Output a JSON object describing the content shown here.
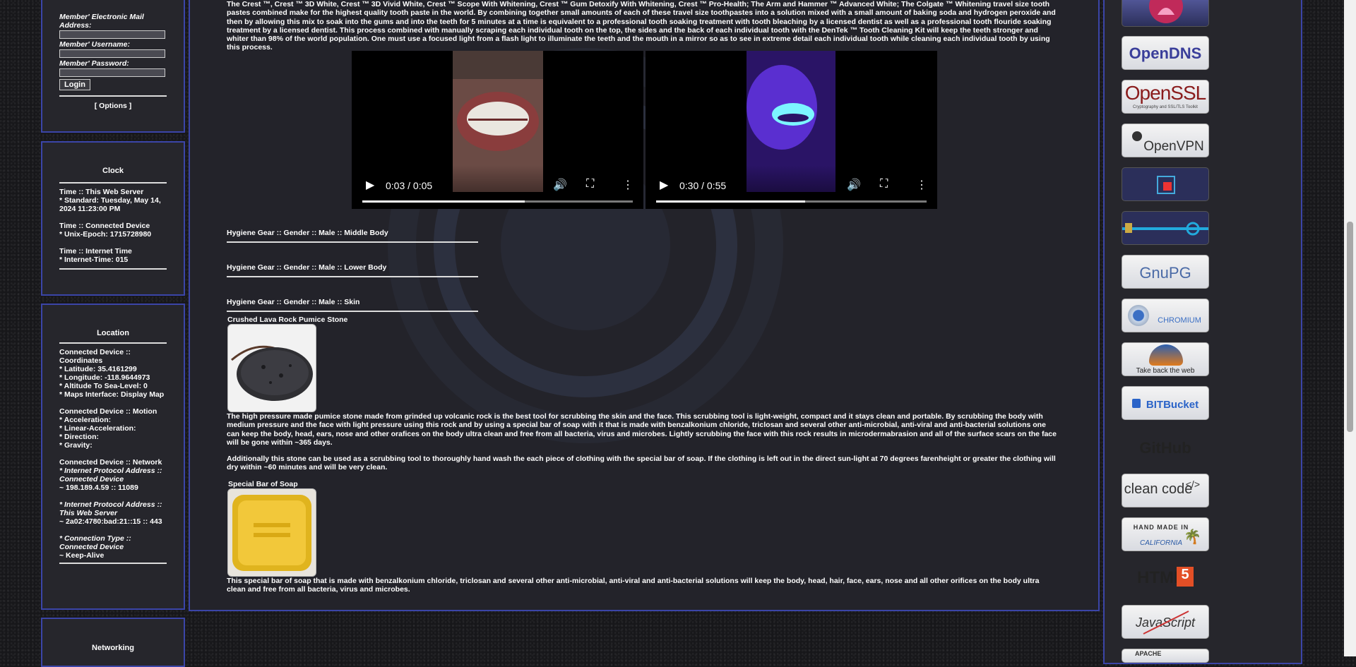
{
  "login": {
    "email_label": "Member' Electronic Mail Address:",
    "username_label": "Member' Username:",
    "password_label": "Member' Password:",
    "login_button": "Login",
    "options_link": "[ Options ]"
  },
  "clock": {
    "title": "Clock",
    "server_heading": "Time :: This Web Server",
    "server_value": "* Standard: Tuesday, May 14, 2024 11:23:00 PM",
    "device_heading": "Time :: Connected Device",
    "device_value": "* Unix-Epoch: 1715728980",
    "internet_heading": "Time :: Internet Time",
    "internet_value": "* Internet-Time: 015"
  },
  "location": {
    "title": "Location",
    "coords_heading": "Connected Device :: Coordinates",
    "latitude": "* Latitude: 35.4161299",
    "longitude": "* Longitude: -118.9644973",
    "altitude": "* Altitude To Sea-Level: 0",
    "maps_label": "* Maps Interface:",
    "maps_link": "Display Map",
    "motion_heading": "Connected Device :: Motion",
    "acceleration": "* Acceleration:",
    "linear_acceleration": "* Linear-Acceleration:",
    "direction": "* Direction:",
    "gravity": "* Gravity:",
    "network_heading": "Connected Device :: Network",
    "ip_device_label": "* Internet Protocol Address :: Connected Device",
    "ip_device_value": "~ 198.189.4.59 :: 11089",
    "ip_server_label": "* Internet Protocol Address :: This Web Server",
    "ip_server_value": "~ 2a02:4780:bad:21::15 :: 443",
    "conn_type_label": "* Connection Type :: Connected Device",
    "conn_type_value": "~ Keep-Alive"
  },
  "networking": {
    "title": "Networking"
  },
  "main": {
    "intro": "The Crest ™, Crest ™ 3D White, Crest ™ 3D Vivid White, Crest ™ Scope With Whitening, Crest ™ Gum Detoxify With Whitening, Crest ™ Pro-Health; The Arm and Hammer ™ Advanced White; The Colgate ™ Whitening travel size tooth pastes combined make for the highest quality tooth paste in the world. By combining together small amounts of each of these travel size toothpastes into a solution mixed with a small amount of baking soda and hydrogen peroxide and then by allowing this mix to soak into the gums and into the teeth for 5 minutes at a time is equivalent to a professional tooth soaking treatment with tooth bleaching by a licensed dentist as well as a professional tooth flouride soaking treatment by a licensed dentist. This process combined with manually scraping each individual tooth on the top, the sides and the back of each individual tooth with the DenTek ™ Tooth Cleaning Kit will keep the teeth stronger and whiter than 98% of the world population. One must use a focused light from a flash light to illuminate the teeth and the mouth in a mirror so as to see in extreme detail each individual tooth while cleaning each individual tooth by using this process.",
    "video1": {
      "time": "0:03 / 0:05",
      "progress": 0.6
    },
    "video2": {
      "time": "0:30 / 0:55",
      "progress": 0.55
    },
    "section_middle": "Hygiene Gear :: Gender :: Male :: Middle Body",
    "section_lower": "Hygiene Gear :: Gender :: Male :: Lower Body",
    "section_skin": "Hygiene Gear :: Gender :: Male :: Skin",
    "pumice_title": "Crushed Lava Rock Pumice Stone",
    "pumice_text": "The high pressure made pumice stone made from grinded up volcanic rock is the best tool for scrubbing the skin and the face. This scrubbing tool is light-weight, compact and it stays clean and portable. By scrubbing the body with medium pressure and the face with light pressure using this rock and by using a special bar of soap with it that is made with benzalkonium chloride, triclosan and several other anti-microbial, anti-viral and anti-bacterial solutions one can keep the body, head, ears, nose and other orafices on the body ultra clean and free from all bacteria, virus and microbes. Lightly scrubbing the face with this rock results in microdermabrasion and all of the surface scars on the face will be gone within ~365 days.",
    "pumice_text2": "Additionally this stone can be used as a scrubbing tool to thoroughly hand wash the each piece of clothing with the special bar of soap. If the clothing is left out in the direct sun-light at 70 degrees farenheight or greater the clothing will dry within ~60 minutes and will be very clean.",
    "soap_title": "Special Bar of Soap",
    "soap_text": "This special bar of soap that is made with benzalkonium chloride, triclosan and several other anti-microbial, anti-viral and anti-bacterial solutions will keep the body, head, hair, face, ears, nose and all other orifices on the body ultra clean and free from all bacteria, virus and microbes."
  },
  "logos": {
    "opendns": "OpenDNS",
    "openssl": "OpenSSL",
    "openssl_sub": "Cryptography and SSL/TLS Toolkit",
    "openvpn": "OpenVPN",
    "gnupg": "GnuPG",
    "chromium": "CHROMIUM",
    "firefox": "Take back the web",
    "bitbucket": "BITBucket",
    "github": "GitHub",
    "cleancode": "clean code",
    "handmade_top": "HAND MADE IN",
    "handmade_bottom": "CALIFORNIA",
    "html5": "HTML",
    "html5_badge": "5",
    "javascript": "JavaScript",
    "apache": "APACHE"
  }
}
